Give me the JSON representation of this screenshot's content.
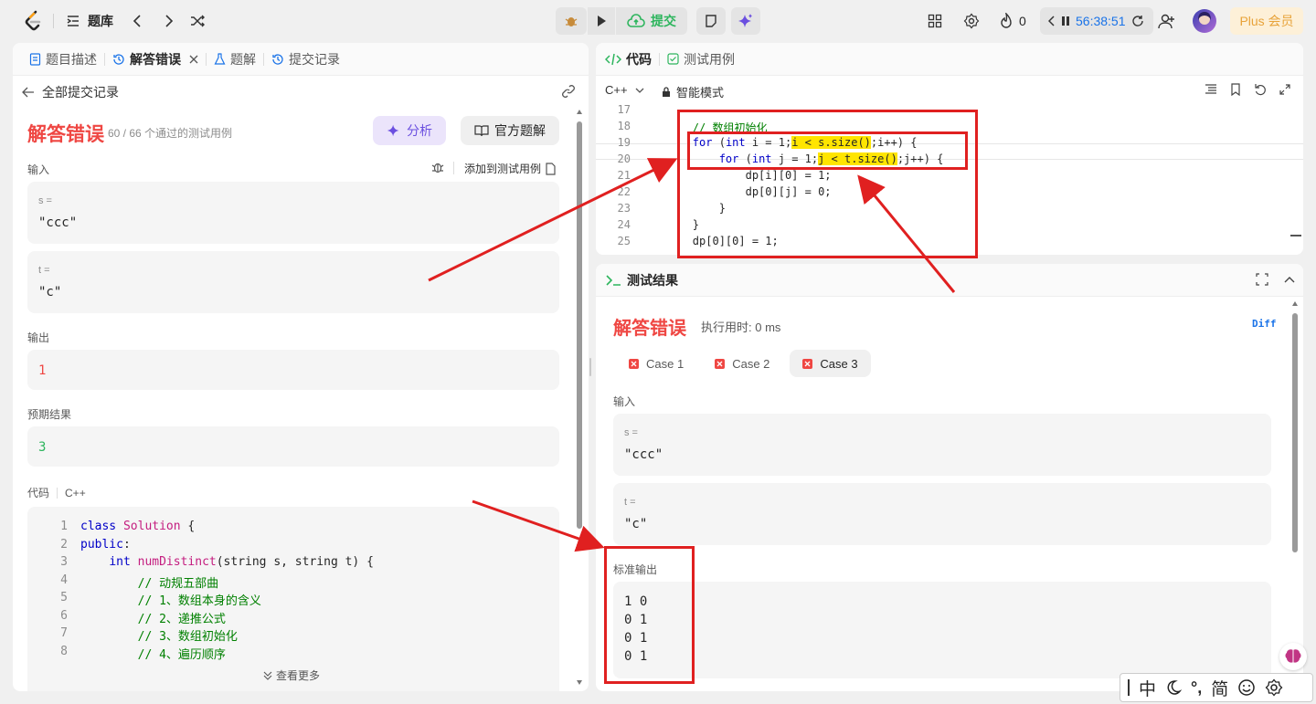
{
  "topbar": {
    "problem_bank": "题库",
    "submit": "提交",
    "flame_count": "0",
    "timer": "56:38:51",
    "plus": "Plus 会员"
  },
  "left": {
    "tabs": [
      "题目描述",
      "解答错误",
      "题解",
      "提交记录"
    ],
    "back": "全部提交记录",
    "verdict": "解答错误",
    "passed": "60 / 66 个通过的测试用例",
    "analyze": "分析",
    "official": "官方题解",
    "input_label": "输入",
    "add_case": "添加到测试用例",
    "s_key": "s =",
    "s_val": "\"ccc\"",
    "t_key": "t =",
    "t_val": "\"c\"",
    "output_label": "输出",
    "output_val": "1",
    "expected_label": "预期结果",
    "expected_val": "3",
    "code_label": "代码",
    "code_lang": "C++",
    "code_lines": [
      {
        "n": "1",
        "t": "class Solution {"
      },
      {
        "n": "2",
        "t": "public:"
      },
      {
        "n": "3",
        "t": "    int numDistinct(string s, string t) {"
      },
      {
        "n": "4",
        "t": "        // 动规五部曲"
      },
      {
        "n": "5",
        "t": "        // 1、数组本身的含义"
      },
      {
        "n": "6",
        "t": "        // 2、递推公式"
      },
      {
        "n": "7",
        "t": "        // 3、数组初始化"
      },
      {
        "n": "8",
        "t": "        // 4、遍历顺序"
      }
    ],
    "more": "查看更多"
  },
  "editor": {
    "tab_code": "代码",
    "tab_tests": "测试用例",
    "lang": "C++",
    "mode": "智能模式",
    "lines": [
      {
        "n": "17",
        "t": ""
      },
      {
        "n": "18",
        "t": "        // 数组初始化"
      },
      {
        "n": "19",
        "t": "        for (int i = 1;i < s.size();i++) {"
      },
      {
        "n": "20",
        "t": "            for (int j = 1;j < t.size();j++) {"
      },
      {
        "n": "21",
        "t": "                dp[i][0] = 1;"
      },
      {
        "n": "22",
        "t": "                dp[0][j] = 0;"
      },
      {
        "n": "23",
        "t": "            }"
      },
      {
        "n": "24",
        "t": "        }"
      },
      {
        "n": "25",
        "t": "        dp[0][0] = 1;"
      }
    ]
  },
  "results": {
    "title": "测试结果",
    "verdict": "解答错误",
    "runtime": "执行用时: 0 ms",
    "diff": "Diff",
    "cases": [
      "Case 1",
      "Case 2",
      "Case 3"
    ],
    "input_label": "输入",
    "s_key": "s =",
    "s_val": "\"ccc\"",
    "t_key": "t =",
    "t_val": "\"c\"",
    "stdout_label": "标准输出",
    "stdout": [
      "1 0",
      "0 1",
      "0 1",
      "0 1"
    ]
  },
  "ime": {
    "chars": [
      "中",
      "°,",
      "简"
    ]
  },
  "colors": {
    "error": "#ef4743",
    "accent": "#2db55d",
    "annot": "#e02020"
  }
}
